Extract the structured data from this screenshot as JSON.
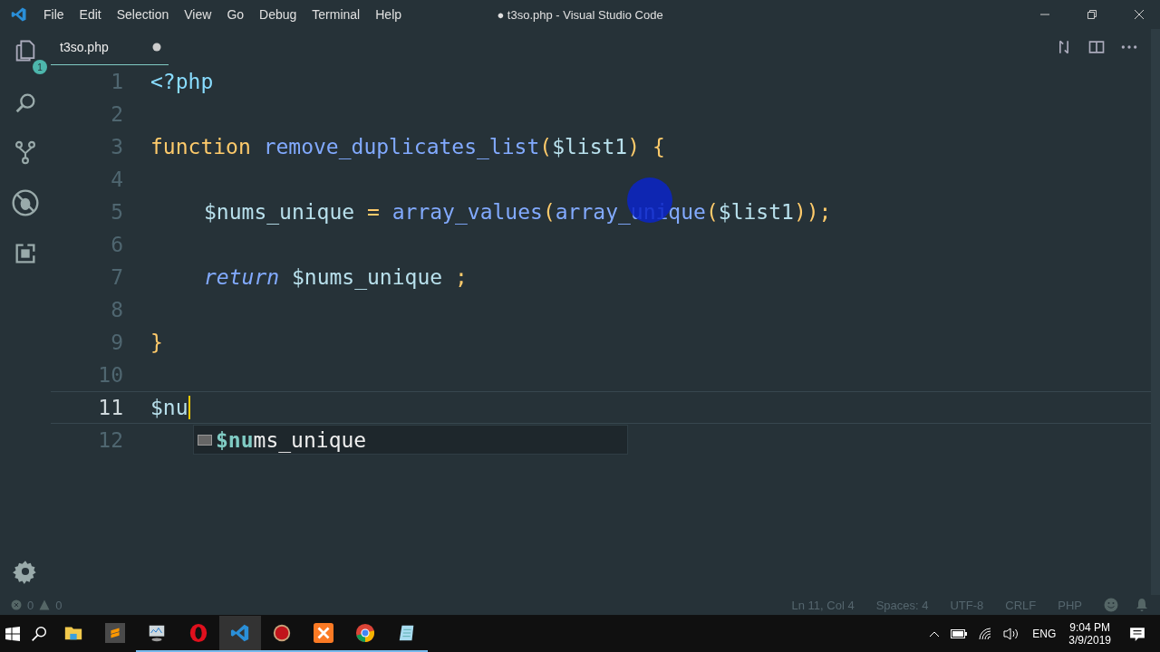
{
  "window": {
    "title": "● t3so.php - Visual Studio Code"
  },
  "menu": [
    "File",
    "Edit",
    "Selection",
    "View",
    "Go",
    "Debug",
    "Terminal",
    "Help"
  ],
  "activity_bar": {
    "explorer_badge": "1"
  },
  "tabs": [
    {
      "label": "t3so.php",
      "selected": true,
      "dirty": true
    }
  ],
  "editor": {
    "lines": [
      {
        "number": "1",
        "indented": false,
        "current": false,
        "tokens": [
          {
            "kind": "tag",
            "text": "<?php"
          }
        ]
      },
      {
        "number": "2",
        "current": false
      },
      {
        "number": "3",
        "indented": false,
        "current": false,
        "tokens": [
          {
            "kind": "keyword",
            "text": "function "
          },
          {
            "kind": "fn",
            "text": "remove_duplicates_list"
          },
          {
            "kind": "punct",
            "text": "("
          },
          {
            "kind": "var",
            "text": "$list1"
          },
          {
            "kind": "punct",
            "text": ") {"
          }
        ]
      },
      {
        "number": "4",
        "current": false
      },
      {
        "number": "5",
        "indented": true,
        "current": false,
        "tokens": [
          {
            "kind": "var",
            "text": "$nums_unique"
          },
          {
            "kind": "op",
            "text": " = "
          },
          {
            "kind": "fn",
            "text": "array_values"
          },
          {
            "kind": "punct",
            "text": "("
          },
          {
            "kind": "fn",
            "text": "array_unique"
          },
          {
            "kind": "punct",
            "text": "("
          },
          {
            "kind": "var",
            "text": "$list1"
          },
          {
            "kind": "punct",
            "text": "));"
          }
        ]
      },
      {
        "number": "6",
        "current": false
      },
      {
        "number": "7",
        "indented": true,
        "current": false,
        "tokens": [
          {
            "kind": "return",
            "text": "return "
          },
          {
            "kind": "var",
            "text": "$nums_unique"
          },
          {
            "kind": "punct",
            "text": " ;"
          }
        ]
      },
      {
        "number": "8",
        "current": false
      },
      {
        "number": "9",
        "indented": false,
        "current": false,
        "tokens": [
          {
            "kind": "punct",
            "text": "}"
          }
        ]
      },
      {
        "number": "10",
        "current": false
      },
      {
        "number": "11",
        "indented": false,
        "current": true,
        "tokens": [
          {
            "kind": "var",
            "text": "$nu"
          }
        ]
      },
      {
        "number": "12",
        "current": false
      }
    ],
    "suggestion": "**$nu**ms_unique"
  },
  "status_bar": {
    "errors": "0",
    "warnings": "0",
    "items": [
      "Ln 11, Col 4",
      "Spaces: 4",
      "UTF-8",
      "CRLF",
      "PHP"
    ]
  },
  "taskbar": {
    "apps": [
      {
        "kind": "folder",
        "running": false,
        "selected": false
      },
      {
        "kind": "sublime",
        "running": false,
        "selected": false
      },
      {
        "kind": "monitor",
        "running": true,
        "selected": false
      },
      {
        "kind": "opera",
        "running": true,
        "selected": false
      },
      {
        "kind": "vscode",
        "running": true,
        "selected": true
      },
      {
        "kind": "record",
        "running": true,
        "selected": false
      },
      {
        "kind": "xampp",
        "running": true,
        "selected": false
      },
      {
        "kind": "chrome",
        "running": true,
        "selected": false
      },
      {
        "kind": "notepad",
        "running": true,
        "selected": false
      }
    ],
    "language": "ENG",
    "time": "9:04 PM",
    "date": "3/9/2019"
  }
}
